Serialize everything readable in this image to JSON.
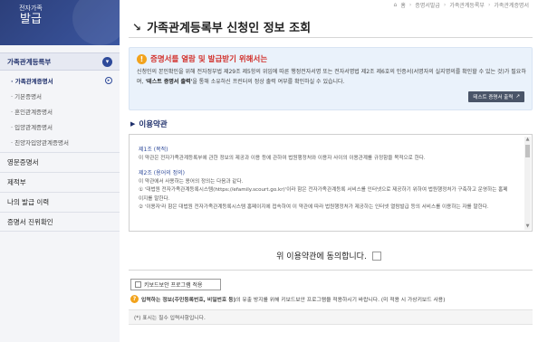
{
  "logo": {
    "line1": "전자가족",
    "line2": "발급"
  },
  "sidebar": {
    "group_title": "가족관계등록부",
    "sub_items": [
      {
        "label": "· 가족관계증명서",
        "active": true
      },
      {
        "label": "· 기본증명서",
        "active": false
      },
      {
        "label": "· 혼인관계증명서",
        "active": false
      },
      {
        "label": "· 입양관계증명서",
        "active": false
      },
      {
        "label": "· 친양자입양관계증명서",
        "active": false
      }
    ],
    "main_items": [
      "영문증명서",
      "제적부",
      "나의 발급 이력",
      "증명서 진위확인"
    ]
  },
  "breadcrumb": [
    "홈",
    "증명서발급",
    "가족관계등록부",
    "가족관계증명서"
  ],
  "page_title": "가족관계등록부 신청인 정보 조회",
  "notice": {
    "title": "증명서를 열람 및 발급받기 위해서는",
    "body_pre": "신청인의 본인확인을 위해 전자정부법 제29조 제5항의 위임에 따른 행정전자서명 또는 전자서명법 제2조 제6호의 인증서(서명자의 실지명의를 확인할 수 있는 것)가 필요하며, ",
    "body_bold": "'테스트 증명서 출력'",
    "body_post": "을 통해 소유하신 프린터의 정상 출력 여부를 확인하실 수 있습니다.",
    "test_button": "테스트 증명서 출력"
  },
  "terms": {
    "section_title": "이용약관",
    "art1_title": "제1조 (목적)",
    "art1_body": "이 약관은 전자가족관계등록부에 관한 정보의 제공과 이용 등에 관하여 법원행정처와 이용자 사이의 이용관계를 규정함을 목적으로 한다.",
    "art2_title": "제2조 (용어의 정의)",
    "art2_intro": "이 약관에서 사용하는 용어의 정의는 다음과 같다.",
    "art2_item1": "① '대법원 전자가족관계등록시스템(https://efamily.scourt.go.kr)'이라 함은 전자가족관계등록 서비스를 인터넷으로 제공하기 위하여 법원행정처가 구축하고 운영하는 홈페이지를 말한다.",
    "art2_item2": "② '이용자'라 함은 대법원 전자가족관계등록시스템 홈페이지에 접속하여 이 약관에 따라 법원행정처가 제공하는 인터넷 열람발급 등의 서비스를 이용하는 자를 말한다."
  },
  "agree_label": "위 이용약관에 동의합니다.",
  "keyboard_security_button": "키보드보안 프로그램 적용",
  "keyboard_notice_pre": "입력하는 정보(주민등록번호, 비밀번호 등)",
  "keyboard_notice_post": "의 유출 방지를 위해 키보드보안 프로그램을 적용하시기 바랍니다. (미 적용 시 가상키보드 사용)",
  "required_note": "(*) 표시는 필수 입력사항입니다."
}
